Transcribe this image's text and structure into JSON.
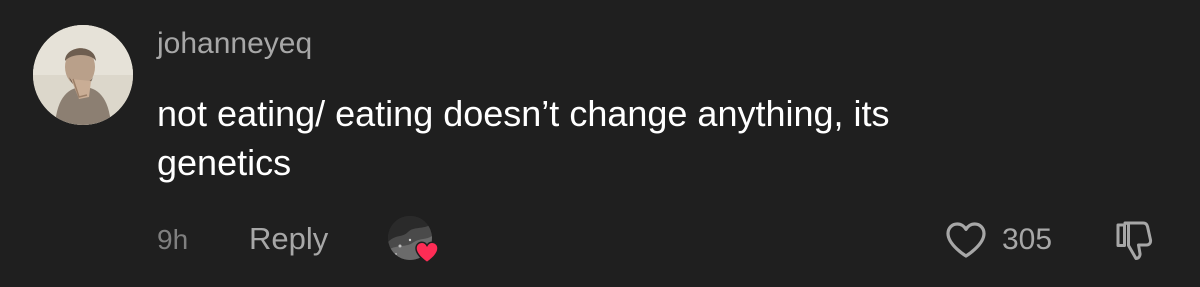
{
  "comment": {
    "username": "johanneyeq",
    "text_line1": "not eating/ eating doesn’t change anything, its",
    "text_line2": "genetics",
    "time": "9h",
    "reply_label": "Reply",
    "like_count": "305",
    "creator_liked": true,
    "icons": {
      "avatar": "user-avatar",
      "creator_avatar": "creator-avatar",
      "creator_heart": "heart-filled-icon",
      "like": "heart-outline-icon",
      "dislike": "thumbs-down-icon"
    },
    "colors": {
      "background": "#1f1f1f",
      "username": "#a7a7a7",
      "text": "#ffffff",
      "meta": "#7f7f7f",
      "heart_red": "#fe2c55"
    }
  }
}
